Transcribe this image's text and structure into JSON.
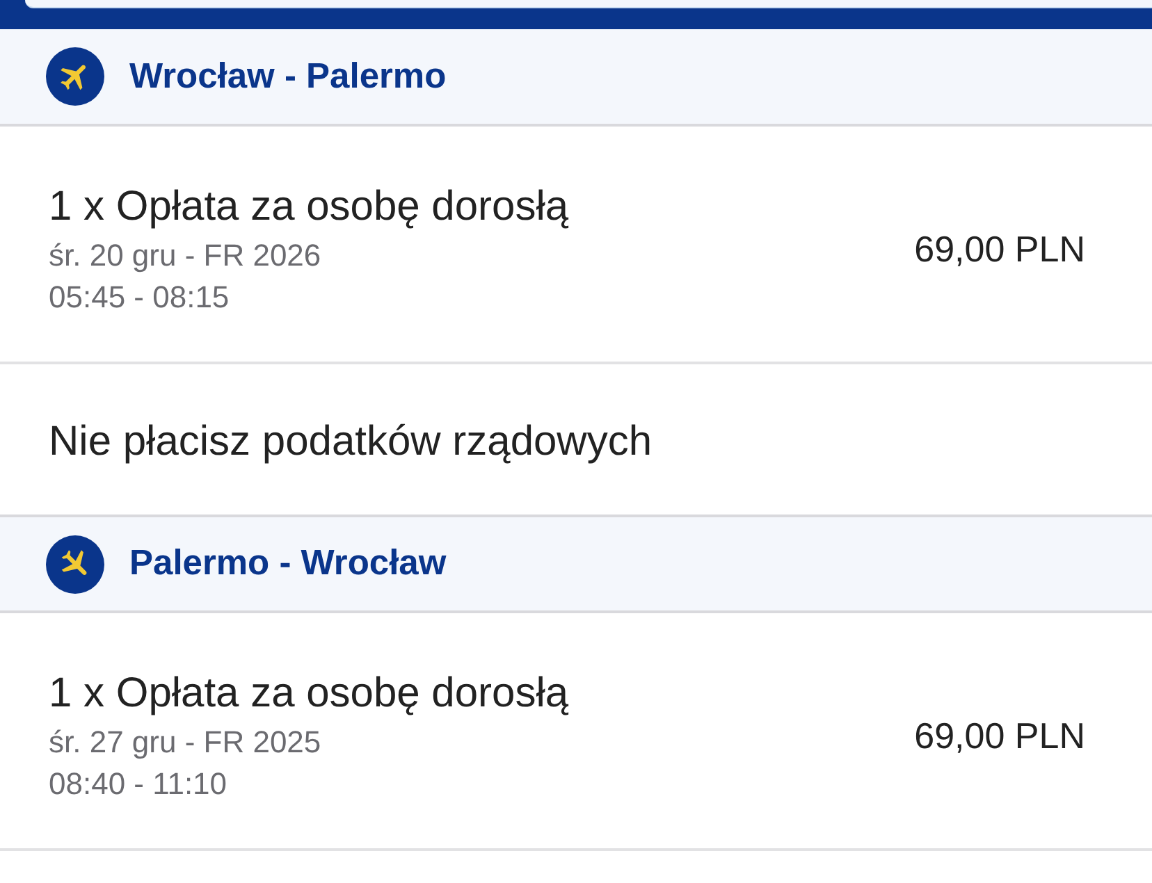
{
  "legs": [
    {
      "kind": "outbound",
      "route": "Wrocław - Palermo",
      "fares": [
        {
          "label": "1 x Opłata za osobę dorosłą",
          "date": "śr. 20 gru - FR 2026",
          "time": "05:45 - 08:15",
          "price": "69,00 PLN"
        }
      ],
      "note": "Nie płacisz podatków rządowych"
    },
    {
      "kind": "return",
      "route": "Palermo - Wrocław",
      "fares": [
        {
          "label": "1 x Opłata za osobę dorosłą",
          "date": "śr. 27 gru - FR 2025",
          "time": "08:40 - 11:10",
          "price": "69,00 PLN"
        }
      ]
    }
  ]
}
